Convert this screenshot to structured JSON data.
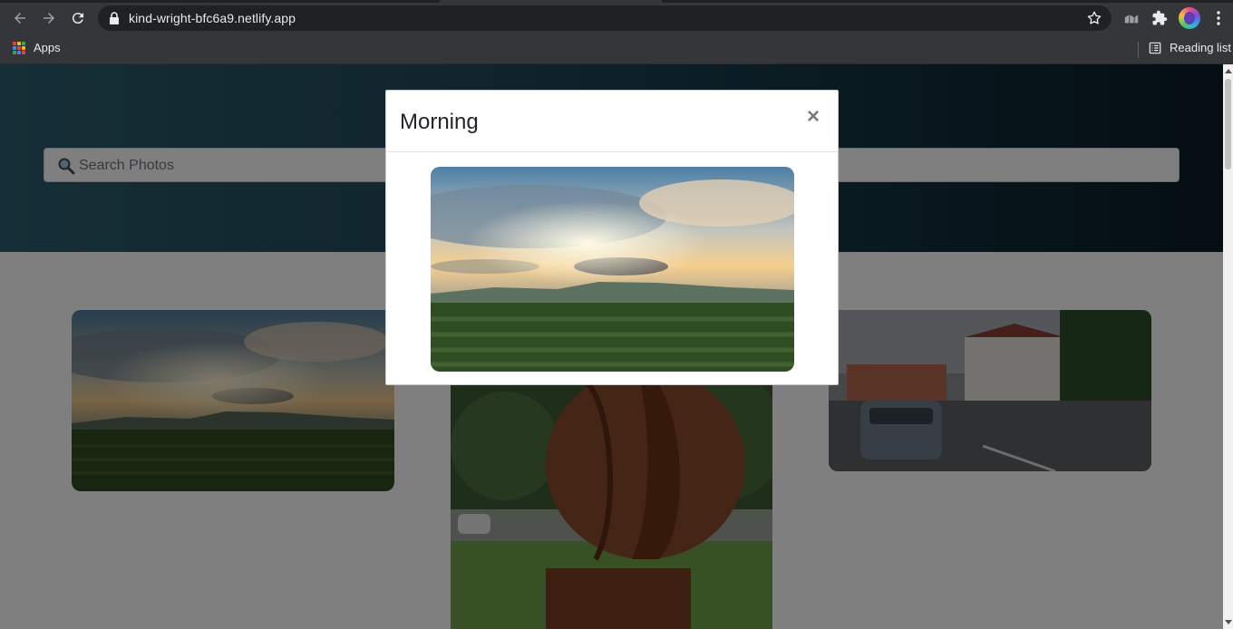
{
  "browser": {
    "url": "kind-wright-bfc6a9.netlify.app",
    "bookmarks": {
      "apps_label": "Apps",
      "reading_list_label": "Reading list"
    }
  },
  "page": {
    "search": {
      "placeholder": "Search Photos"
    },
    "gallery": [
      {
        "kind": "landscape-sunrise-vineyard"
      },
      {
        "kind": "rusted-metal-sculpture"
      },
      {
        "kind": "street-with-pub-and-car"
      }
    ]
  },
  "modal": {
    "title": "Morning",
    "close_label": "×",
    "image": "landscape-sunrise-vineyard"
  },
  "colors": {
    "hero_start": "#2c5d6e",
    "hero_end": "#0a1c25",
    "chrome": "#35363a",
    "omnibox": "#202124"
  }
}
